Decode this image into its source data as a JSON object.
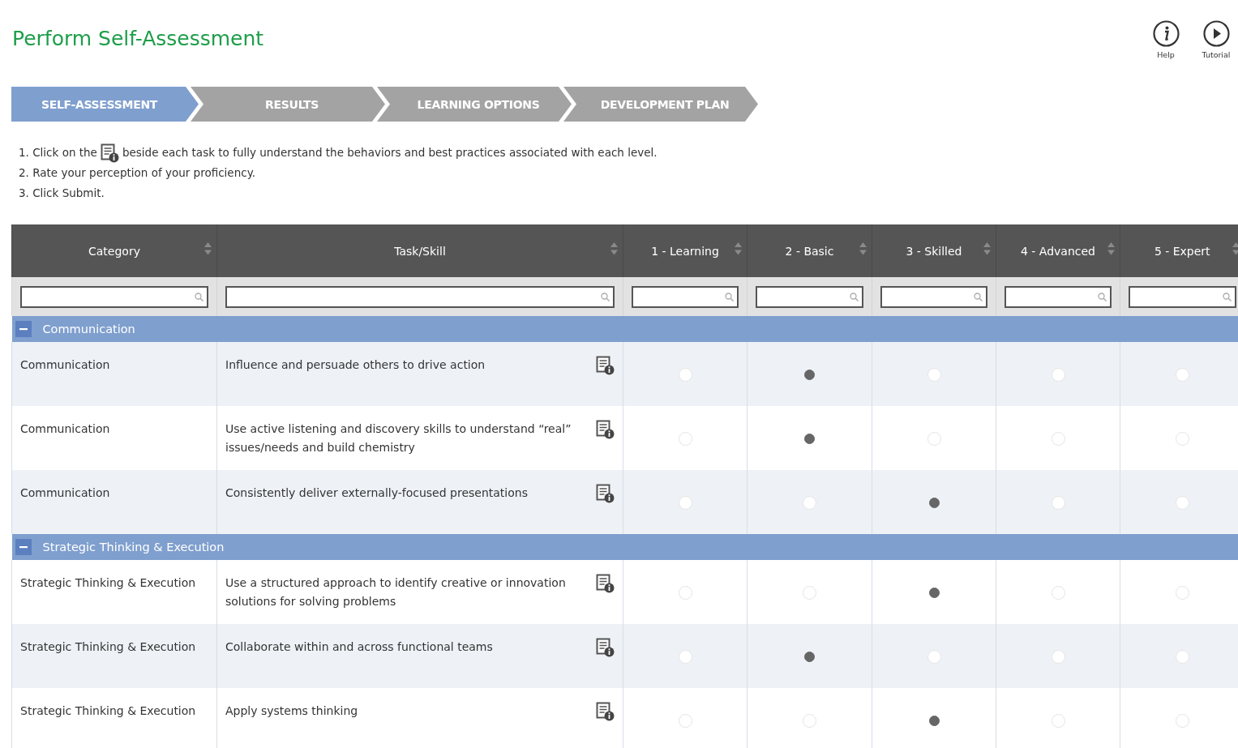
{
  "title": "Perform Self-Assessment",
  "toolbar": [
    {
      "kind": "help",
      "label": "Help"
    },
    {
      "kind": "tutorial",
      "label": "Tutorial"
    }
  ],
  "steps": [
    {
      "label": "SELF-ASSESSMENT",
      "selected": true
    },
    {
      "label": "RESULTS",
      "selected": false
    },
    {
      "label": "LEARNING OPTIONS",
      "selected": false
    },
    {
      "label": "DEVELOPMENT PLAN",
      "selected": false
    }
  ],
  "instructions": [
    {
      "kind": "icon_text",
      "before": "1. Click on the",
      "after": "beside each task to fully understand the behaviors and best practices associated with each level."
    },
    {
      "kind": "text",
      "text": "2. Rate your perception of your proficiency."
    },
    {
      "kind": "text",
      "text": "3. Click Submit."
    }
  ],
  "table": {
    "columns": [
      "Category",
      "Task/Skill",
      "1 - Learning",
      "2 - Basic",
      "3 - Skilled",
      "4 - Advanced",
      "5 - Expert"
    ],
    "groups": [
      {
        "name": "Communication",
        "expanded": true,
        "rows": [
          {
            "category": "Communication",
            "task": "Influence and persuade others to drive action",
            "ratings": [
              {
                "selected": false
              },
              {
                "selected": true
              },
              {
                "selected": false
              },
              {
                "selected": false
              },
              {
                "selected": false
              }
            ]
          },
          {
            "category": "Communication",
            "task": "Use active listening and discovery skills to understand “real” issues/needs and build chemistry",
            "ratings": [
              {
                "selected": false
              },
              {
                "selected": true
              },
              {
                "selected": false
              },
              {
                "selected": false
              },
              {
                "selected": false
              }
            ]
          },
          {
            "category": "Communication",
            "task": "Consistently deliver externally-focused presentations",
            "ratings": [
              {
                "selected": false
              },
              {
                "selected": false
              },
              {
                "selected": true
              },
              {
                "selected": false
              },
              {
                "selected": false
              }
            ]
          }
        ]
      },
      {
        "name": "Strategic Thinking & Execution",
        "expanded": true,
        "rows": [
          {
            "category": "Strategic Thinking & Execution",
            "task": "Use a structured approach to identify creative or innovation solutions for solving problems",
            "ratings": [
              {
                "selected": false
              },
              {
                "selected": false
              },
              {
                "selected": true
              },
              {
                "selected": false
              },
              {
                "selected": false
              }
            ]
          },
          {
            "category": "Strategic Thinking & Execution",
            "task": "Collaborate within and across functional teams",
            "ratings": [
              {
                "selected": false
              },
              {
                "selected": true
              },
              {
                "selected": false
              },
              {
                "selected": false
              },
              {
                "selected": false
              }
            ]
          },
          {
            "category": "Strategic Thinking & Execution",
            "task": "Apply systems thinking",
            "ratings": [
              {
                "selected": false
              },
              {
                "selected": false
              },
              {
                "selected": true
              },
              {
                "selected": false
              },
              {
                "selected": false
              }
            ]
          }
        ]
      }
    ]
  }
}
